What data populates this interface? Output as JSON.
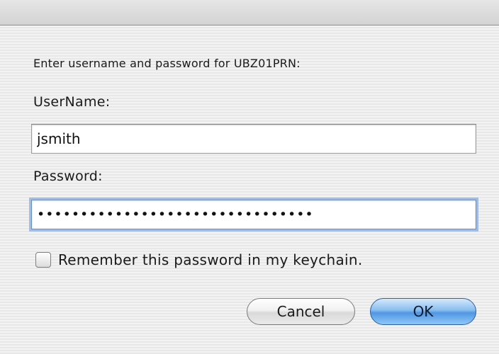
{
  "dialog": {
    "prompt": "Enter username and password for UBZ01PRN:",
    "username_label": "UserName:",
    "username_value": "jsmith",
    "password_label": "Password:",
    "password_value": "••••••••••••••••••••••••••••••••",
    "remember_label": "Remember this password in my keychain.",
    "remember_checked": false,
    "cancel_label": "Cancel",
    "ok_label": "OK"
  },
  "colors": {
    "default_button": "#4f97e3",
    "focus_ring": "#9fbde6"
  }
}
